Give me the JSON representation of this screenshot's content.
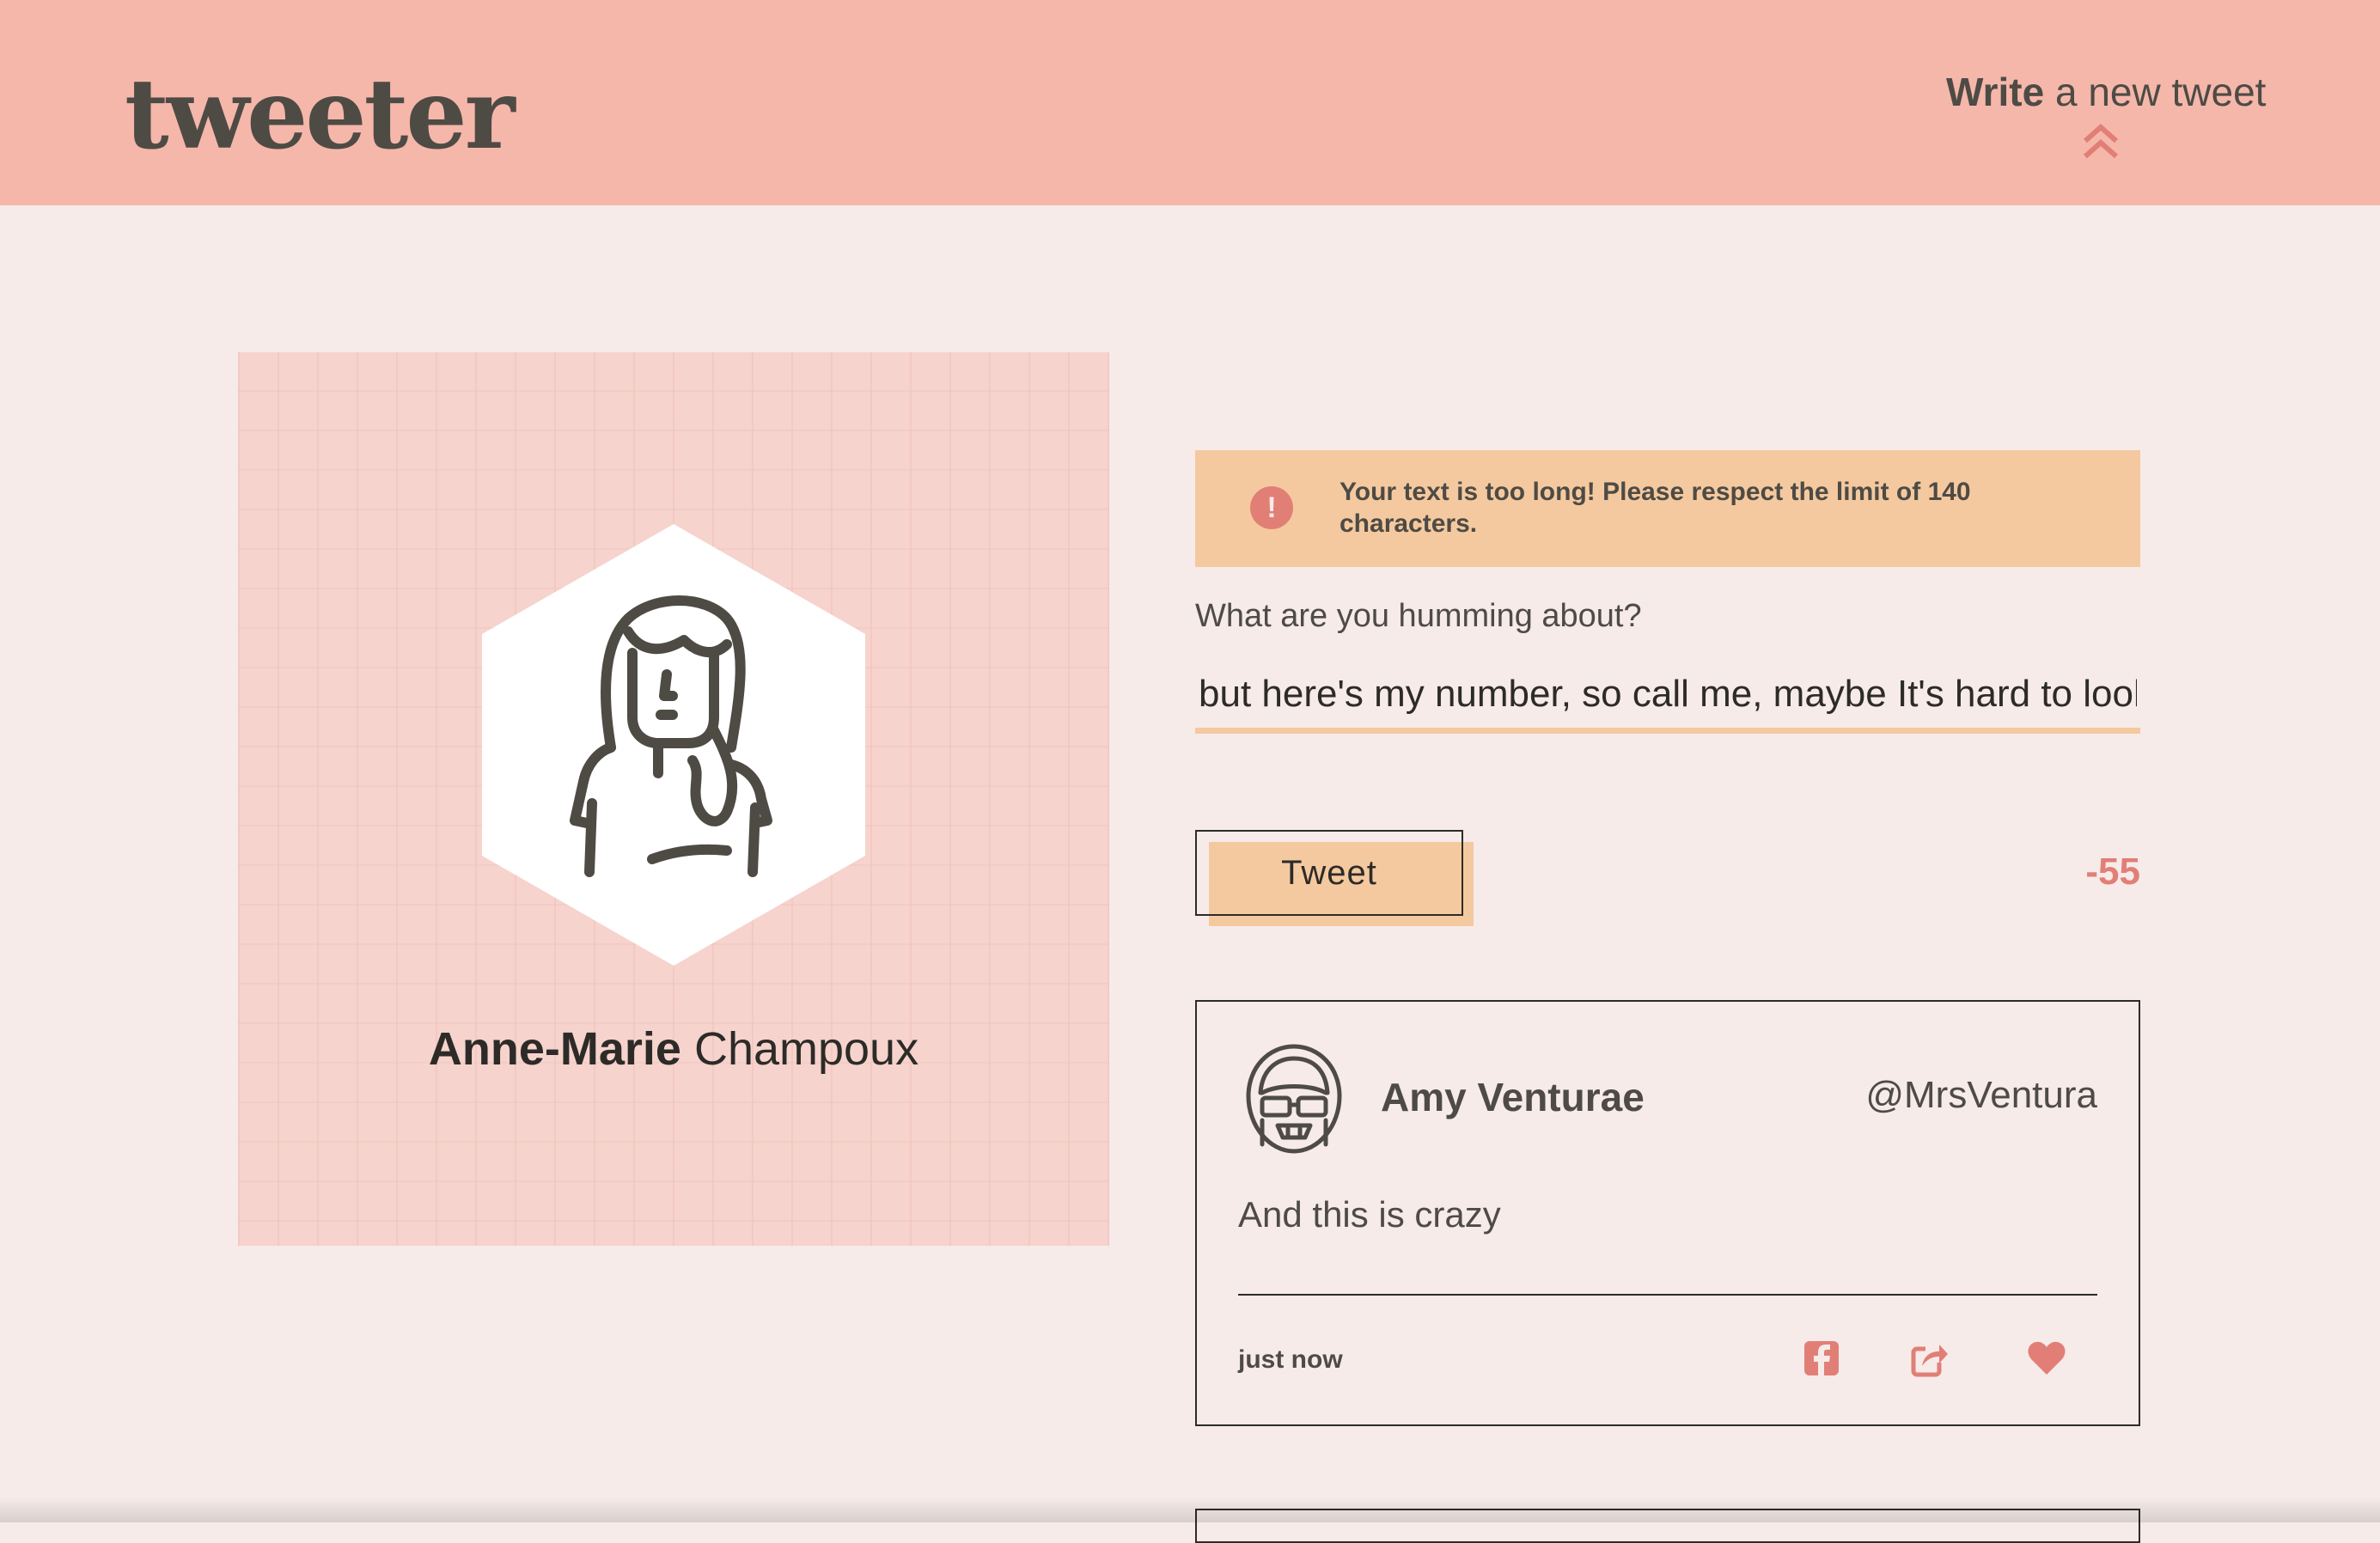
{
  "header": {
    "logo": "tweeter",
    "compose_toggle_bold": "Write",
    "compose_toggle_rest": "a new tweet",
    "toggle_icon": "double-chevron-up-icon"
  },
  "profile": {
    "first_name": "Anne-Marie",
    "last_name": "Champoux",
    "avatar_icon": "woman-avatar-icon"
  },
  "composer": {
    "error_icon": "exclamation-circle-icon",
    "error_message": "Your text is too long! Please respect the limit of 140 characters.",
    "label": "What are you humming about?",
    "input_value": "but here's my number, so call me, maybe It's hard to look",
    "submit_label": "Tweet",
    "char_counter": "-55"
  },
  "tweets": [
    {
      "author": "Amy Venturae",
      "handle": "@MrsVentura",
      "content": "And this is crazy",
      "timestamp": "just now",
      "avatar_icon": "woman-sunglasses-avatar-icon",
      "actions": [
        "facebook-icon",
        "share-icon",
        "heart-icon"
      ]
    }
  ],
  "colors": {
    "navbar": "#f5b7aa",
    "background": "#f6ebe9",
    "accent": "#e17f77",
    "warning": "#f5c99f",
    "text": "#4e4b45"
  }
}
